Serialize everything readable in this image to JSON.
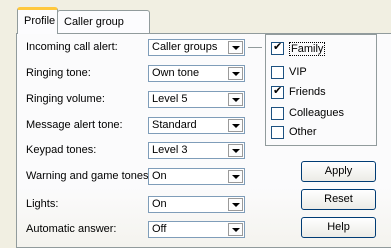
{
  "tabs": [
    {
      "label": "Profile"
    },
    {
      "label": "Caller group"
    }
  ],
  "settings": [
    {
      "label": "Incoming call alert:",
      "value": "Caller groups"
    },
    {
      "label": "Ringing tone:",
      "value": "Own tone"
    },
    {
      "label": "Ringing volume:",
      "value": "Level 5"
    },
    {
      "label": "Message alert tone:",
      "value": "Standard"
    },
    {
      "label": "Keypad tones:",
      "value": "Level 3"
    },
    {
      "label": "Warning and game tones:",
      "value": "On"
    },
    {
      "label": "Lights:",
      "value": "On"
    },
    {
      "label": "Automatic answer:",
      "value": "Off"
    }
  ],
  "caller_groups": [
    {
      "label": "Family",
      "checked": true
    },
    {
      "label": "VIP",
      "checked": false
    },
    {
      "label": "Friends",
      "checked": true
    },
    {
      "label": "Colleagues",
      "checked": false
    },
    {
      "label": "Other",
      "checked": false
    }
  ],
  "buttons": {
    "apply": "Apply",
    "reset": "Reset",
    "help": "Help"
  }
}
